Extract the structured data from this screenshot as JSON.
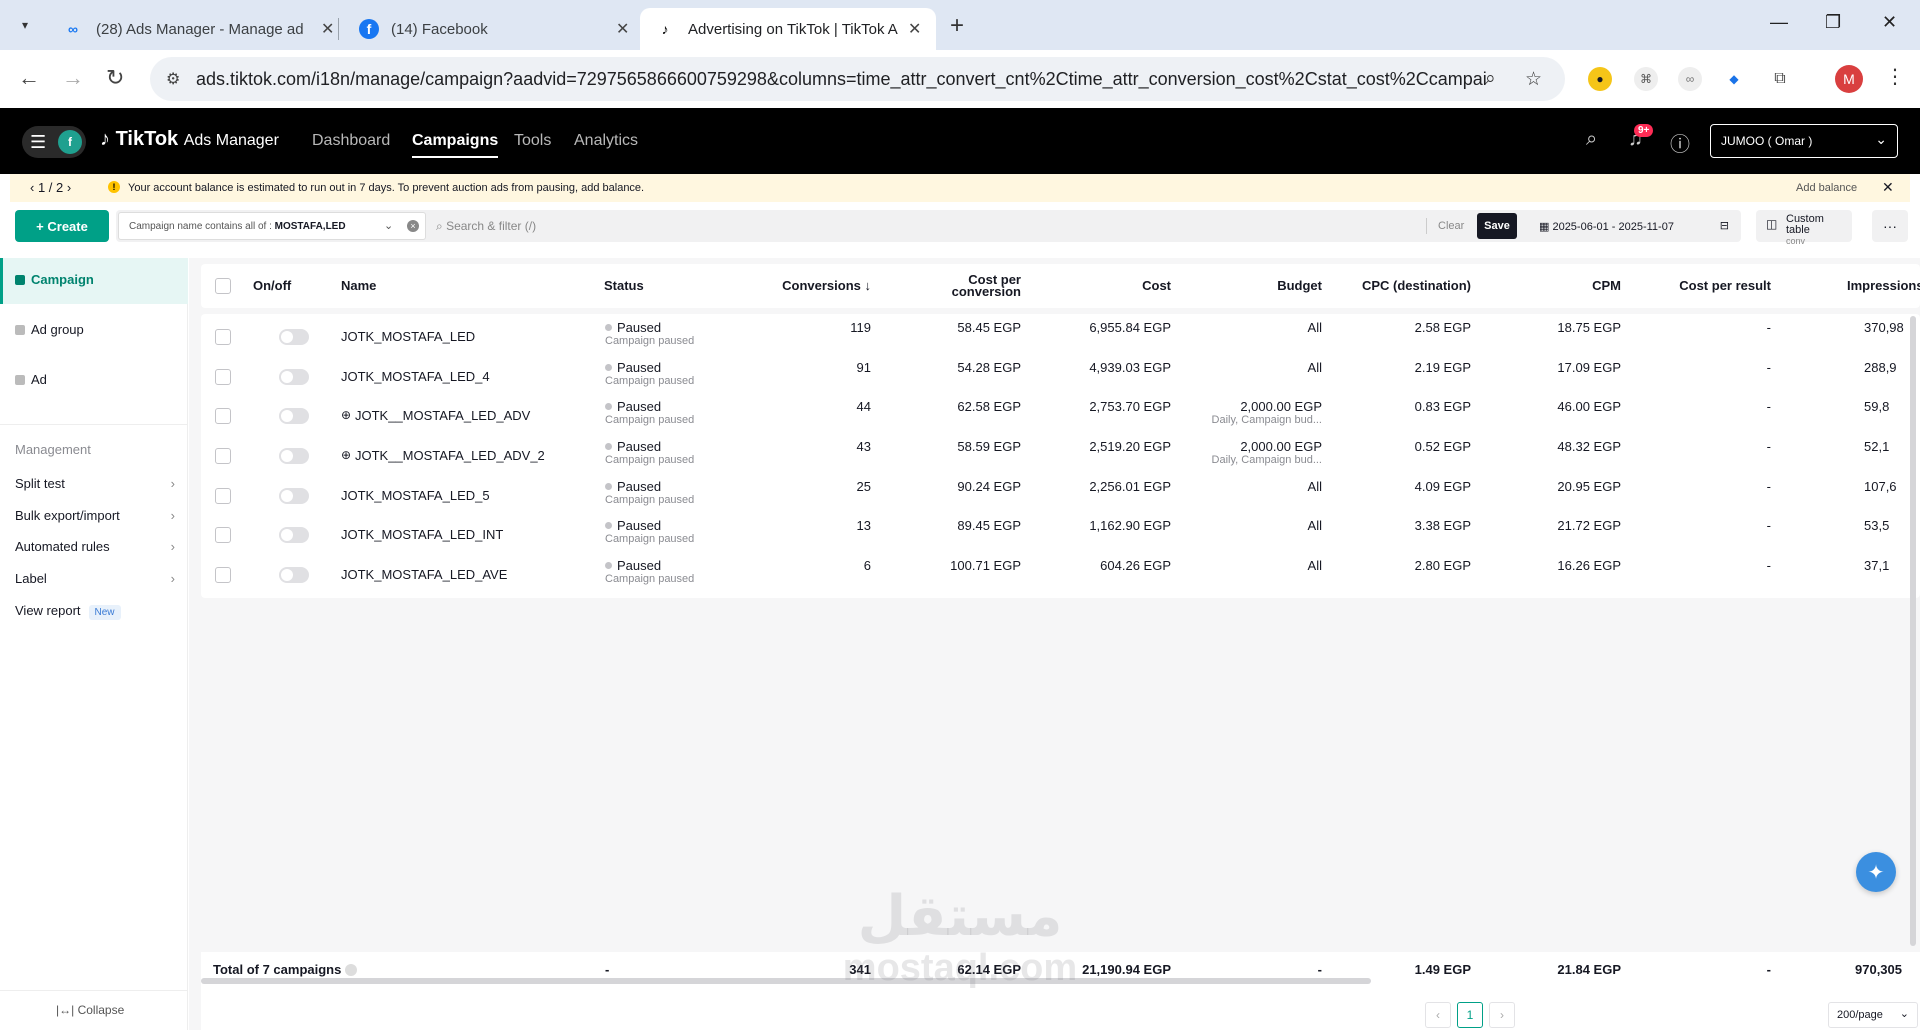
{
  "browser": {
    "tabs": [
      {
        "title": "(28) Ads Manager - Manage ad",
        "icon": "meta-icon"
      },
      {
        "title": "(14) Facebook",
        "icon": "facebook-icon"
      },
      {
        "title": "Advertising on TikTok | TikTok A",
        "icon": "tiktok-icon"
      }
    ],
    "url": "ads.tiktok.com/i18n/manage/campaign?aadvid=7297565866600759298&columns=time_attr_convert_cnt%2Ctime_attr_conversion_cost%2Cstat_cost%2Ccampaign_...",
    "profile_initial": "M"
  },
  "header": {
    "brand": "TikTok",
    "brand_sub": "Ads Manager",
    "workspace_initial": "f",
    "nav": [
      "Dashboard",
      "Campaigns",
      "Tools",
      "Analytics"
    ],
    "active_nav": "Campaigns",
    "notification_badge": "9+",
    "account": "JUMOO ( Omar )"
  },
  "notice": {
    "pager": "1 / 2",
    "message": "Your account balance is estimated to run out in 7 days. To prevent auction ads from pausing, add balance.",
    "action": "Add balance"
  },
  "filter": {
    "create_label": "Create",
    "chip_prefix": "Campaign name contains all of :",
    "chip_value": "MOSTAFA,LED",
    "search_placeholder": "Search & filter (/)",
    "clear_label": "Clear",
    "save_label": "Save",
    "date_range": "2025-06-01 - 2025-11-07",
    "custom_table": "Custom table",
    "custom_table_sub": "conv"
  },
  "sidebar": {
    "levels": [
      "Campaign",
      "Ad group",
      "Ad"
    ],
    "management_label": "Management",
    "items": [
      "Split test",
      "Bulk export/import",
      "Automated rules",
      "Label"
    ],
    "view_report": "View report",
    "new_badge": "New",
    "collapse": "Collapse"
  },
  "table": {
    "columns": [
      "On/off",
      "Name",
      "Status",
      "Conversions ↓",
      "Cost per",
      "conversion",
      "Cost",
      "Budget",
      "CPC (destination)",
      "CPM",
      "Cost per result",
      "Impressions"
    ],
    "rows": [
      {
        "name": "JOTK_MOSTAFA_LED",
        "status": "Paused",
        "status_sub": "Campaign paused",
        "conversions": "119",
        "cpa": "58.45 EGP",
        "cost": "6,955.84 EGP",
        "budget": "All",
        "budget_sub": "",
        "cpc": "2.58 EGP",
        "cpm": "18.75 EGP",
        "cpr": "-",
        "impressions": "370,98"
      },
      {
        "name": "JOTK_MOSTAFA_LED_4",
        "status": "Paused",
        "status_sub": "Campaign paused",
        "conversions": "91",
        "cpa": "54.28 EGP",
        "cost": "4,939.03 EGP",
        "budget": "All",
        "budget_sub": "",
        "cpc": "2.19 EGP",
        "cpm": "17.09 EGP",
        "cpr": "-",
        "impressions": "288,9"
      },
      {
        "name": "JOTK__MOSTAFA_LED_ADV",
        "status": "Paused",
        "status_sub": "Campaign paused",
        "conversions": "44",
        "cpa": "62.58 EGP",
        "cost": "2,753.70 EGP",
        "budget": "2,000.00 EGP",
        "budget_sub": "Daily, Campaign bud...",
        "cpc": "0.83 EGP",
        "cpm": "46.00 EGP",
        "cpr": "-",
        "impressions": "59,8"
      },
      {
        "name": "JOTK__MOSTAFA_LED_ADV_2",
        "status": "Paused",
        "status_sub": "Campaign paused",
        "conversions": "43",
        "cpa": "58.59 EGP",
        "cost": "2,519.20 EGP",
        "budget": "2,000.00 EGP",
        "budget_sub": "Daily, Campaign bud...",
        "cpc": "0.52 EGP",
        "cpm": "48.32 EGP",
        "cpr": "-",
        "impressions": "52,1"
      },
      {
        "name": "JOTK_MOSTAFA_LED_5",
        "status": "Paused",
        "status_sub": "Campaign paused",
        "conversions": "25",
        "cpa": "90.24 EGP",
        "cost": "2,256.01 EGP",
        "budget": "All",
        "budget_sub": "",
        "cpc": "4.09 EGP",
        "cpm": "20.95 EGP",
        "cpr": "-",
        "impressions": "107,6"
      },
      {
        "name": "JOTK_MOSTAFA_LED_INT",
        "status": "Paused",
        "status_sub": "Campaign paused",
        "conversions": "13",
        "cpa": "89.45 EGP",
        "cost": "1,162.90 EGP",
        "budget": "All",
        "budget_sub": "",
        "cpc": "3.38 EGP",
        "cpm": "21.72 EGP",
        "cpr": "-",
        "impressions": "53,5"
      },
      {
        "name": "JOTK_MOSTAFA_LED_AVE",
        "status": "Paused",
        "status_sub": "Campaign paused",
        "conversions": "6",
        "cpa": "100.71 EGP",
        "cost": "604.26 EGP",
        "budget": "All",
        "budget_sub": "",
        "cpc": "2.80 EGP",
        "cpm": "16.26 EGP",
        "cpr": "-",
        "impressions": "37,1"
      }
    ],
    "total": {
      "label": "Total of 7 campaigns",
      "status": "-",
      "conversions": "341",
      "cpa": "62.14 EGP",
      "cost": "21,190.94 EGP",
      "budget": "-",
      "cpc": "1.49 EGP",
      "cpm": "21.84 EGP",
      "cpr": "-",
      "impressions": "970,305"
    },
    "page": "1",
    "per_page": "200/page"
  },
  "watermark": {
    "arabic": "مستقل",
    "latin": "mostaql.com"
  },
  "colors": {
    "accent": "#00a087",
    "brand_bg": "#000000",
    "notice_bg": "#fff7e0",
    "danger": "#fe2c55"
  }
}
